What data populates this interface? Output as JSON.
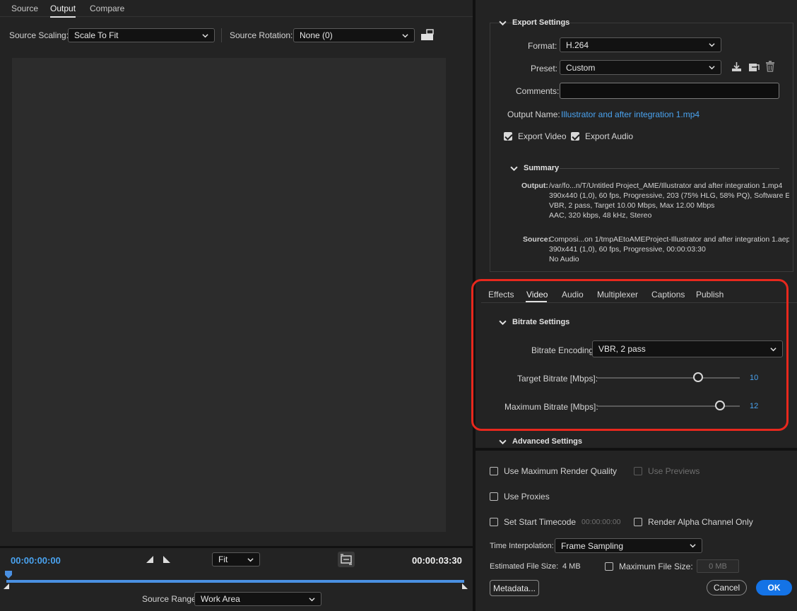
{
  "left": {
    "tabs": [
      "Source",
      "Output",
      "Compare"
    ],
    "active_tab": "Output",
    "source_scaling_label": "Source Scaling:",
    "source_scaling_value": "Scale To Fit",
    "source_rotation_label": "Source Rotation:",
    "source_rotation_value": "None (0)",
    "timecode_start": "00:00:00:00",
    "timecode_end": "00:00:03:30",
    "zoom_value": "Fit",
    "source_range_label": "Source Range:",
    "source_range_value": "Work Area"
  },
  "export": {
    "title": "Export Settings",
    "format_label": "Format:",
    "format_value": "H.264",
    "preset_label": "Preset:",
    "preset_value": "Custom",
    "comments_label": "Comments:",
    "comments_value": "",
    "output_name_label": "Output Name:",
    "output_name_value": "Illustrator and after integration 1.mp4",
    "export_video_label": "Export Video",
    "export_video_checked": true,
    "export_audio_label": "Export Audio",
    "export_audio_checked": true
  },
  "summary": {
    "title": "Summary",
    "output_label": "Output:",
    "output_lines": [
      "/var/fo...n/T/Untitled Project_AME/Illustrator and after integration 1.mp4",
      "390x440 (1,0), 60 fps, Progressive, 203 (75% HLG, 58% PQ), Software E...",
      "VBR, 2 pass, Target 10.00 Mbps, Max 12.00 Mbps",
      "AAC, 320 kbps, 48 kHz, Stereo"
    ],
    "source_label": "Source:",
    "source_lines": [
      "Composi...on 1/tmpAEtoAMEProject-Illustrator and after integration 1.aep",
      "390x441 (1,0), 60 fps, Progressive, 00:00:03:30",
      "No Audio"
    ]
  },
  "settings_tabs": [
    "Effects",
    "Video",
    "Audio",
    "Multiplexer",
    "Captions",
    "Publish"
  ],
  "active_settings_tab": "Video",
  "bitrate": {
    "title": "Bitrate Settings",
    "encoding_label": "Bitrate Encoding:",
    "encoding_value": "VBR, 2 pass",
    "target_label": "Target Bitrate [Mbps]:",
    "target_value": "10",
    "target_fraction": 0.71,
    "max_label": "Maximum Bitrate [Mbps]:",
    "max_value": "12",
    "max_fraction": 0.86
  },
  "advanced": {
    "title": "Advanced Settings"
  },
  "bottom": {
    "use_max_render_quality": "Use Maximum Render Quality",
    "use_previews": "Use Previews",
    "use_proxies": "Use Proxies",
    "set_start_timecode": "Set Start Timecode",
    "start_timecode_value": "00:00:00:00",
    "render_alpha_only": "Render Alpha Channel Only",
    "time_interpolation_label": "Time Interpolation:",
    "time_interpolation_value": "Frame Sampling",
    "estimated_size_label": "Estimated File Size:",
    "estimated_size_value": "4 MB",
    "max_file_size_label": "Maximum File Size:",
    "max_file_size_placeholder": "0 MB",
    "metadata_button": "Metadata...",
    "cancel_button": "Cancel",
    "ok_button": "OK"
  },
  "colors": {
    "accent": "#1473e6",
    "link": "#4aa3f0",
    "highlight": "#e8281d"
  }
}
